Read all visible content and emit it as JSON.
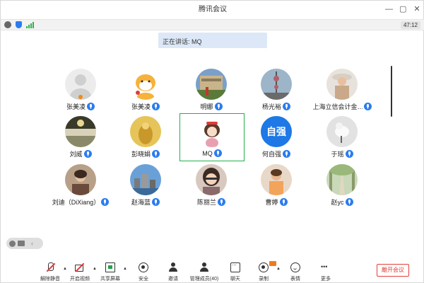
{
  "window": {
    "title": "腾讯会议"
  },
  "window_controls": [
    "minimize",
    "maximize",
    "close"
  ],
  "status_bar": {
    "time": "47:12"
  },
  "toast": {
    "text": "正在讲话: MQ"
  },
  "participants": [
    {
      "name": "张美凌",
      "avatar": "default-gray"
    },
    {
      "name": "张美凌",
      "avatar": "cartoon-dog"
    },
    {
      "name": "明娜",
      "avatar": "building-photo"
    },
    {
      "name": "杨光裕",
      "avatar": "tower-photo"
    },
    {
      "name": "上海立信会计金…",
      "avatar": "woman-hat-photo"
    },
    {
      "name": "刘威",
      "avatar": "landscape-photo"
    },
    {
      "name": "彭晓娟",
      "avatar": "golden-statue-photo"
    },
    {
      "name": "MQ",
      "avatar": "cartoon-girl"
    },
    {
      "name": "何自强",
      "avatar": "text-avatar",
      "avatar_text": "自强"
    },
    {
      "name": "于瑶",
      "avatar": "bird-photo"
    },
    {
      "name": "刘迪（DiXiang）",
      "avatar": "woman-indoor-photo"
    },
    {
      "name": "赵海蓝",
      "avatar": "city-photo"
    },
    {
      "name": "陈丽兰",
      "avatar": "woman-selfie-photo"
    },
    {
      "name": "曹婷",
      "avatar": "woman-outdoor-photo"
    },
    {
      "name": "赵yc",
      "avatar": "tree-path-photo"
    }
  ],
  "toolbar": {
    "mute": "解除静音",
    "video": "开启视频",
    "share": "共享屏幕",
    "security": "安全",
    "invite": "邀请",
    "members": "管理成员(40)",
    "chat": "聊天",
    "record": "录制",
    "reactions": "表情",
    "more": "更多",
    "leave": "離开会议"
  },
  "colors": {
    "accent": "#2a7df0",
    "active_border": "#21b14a",
    "danger": "#e0403a",
    "mute_red": "#e23a3a"
  }
}
